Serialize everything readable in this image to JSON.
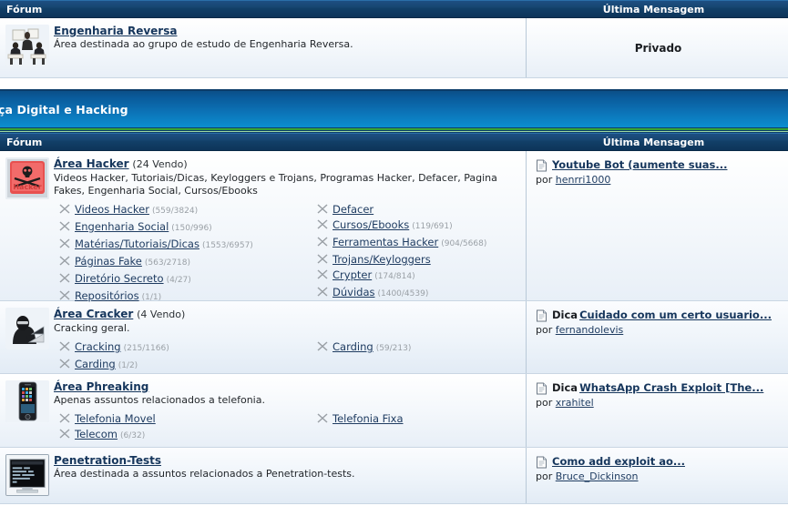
{
  "top_table": {
    "headers": {
      "forum": "Fórum",
      "last_message": "Última Mensagem"
    },
    "rows": [
      {
        "icon": "meeting-photo-icon",
        "title": "Engenharia Reversa",
        "count": "",
        "description": "Área destinada ao grupo de estudo de Engenharia Reversa.",
        "subforums_col1": [],
        "subforums_col2": [],
        "last_message_static": "Privado"
      }
    ]
  },
  "category": {
    "banner_title": "ça Digital e Hacking",
    "headers": {
      "forum": "Fórum",
      "last_message": "Última Mensagem"
    },
    "rows": [
      {
        "icon": "hacker-key-icon",
        "title": "Área Hacker",
        "count": "(24 Vendo)",
        "description": "Videos Hacker, Tutoriais/Dicas, Keyloggers e Trojans, Programas Hacker, Defacer, Pagina Fakes, Engenharia Social, Cursos/Ebooks",
        "subforums_col1": [
          {
            "label": "Videos Hacker",
            "stats": "(559/3824)"
          },
          {
            "label": "Engenharia Social",
            "stats": "(150/996)"
          },
          {
            "label": "Matérias/Tutoriais/Dicas",
            "stats": "(1553/6957)"
          },
          {
            "label": "Páginas Fake",
            "stats": "(563/2718)"
          },
          {
            "label": "Diretório Secreto",
            "stats": "(4/27)"
          },
          {
            "label": "Repositórios",
            "stats": "(1/1)"
          }
        ],
        "subforums_col2": [
          {
            "label": "Defacer",
            "stats": ""
          },
          {
            "label": "Cursos/Ebooks",
            "stats": "(119/691)"
          },
          {
            "label": "Ferramentas Hacker",
            "stats": "(904/5668)"
          },
          {
            "label": "Trojans/Keyloggers",
            "stats": ""
          },
          {
            "label": "Crypter",
            "stats": "(174/814)"
          },
          {
            "label": "Dúvidas",
            "stats": "(1400/4539)"
          }
        ],
        "last_message": {
          "prefix": "",
          "title": "Youtube Bot (aumente suas...",
          "by_label": "por",
          "author": "henrri1000"
        }
      },
      {
        "icon": "masked-hacker-laptop-icon",
        "title": "Área Cracker",
        "count": "(4 Vendo)",
        "description": "Cracking geral.",
        "subforums_col1": [
          {
            "label": "Cracking",
            "stats": "(215/1166)"
          },
          {
            "label": "Carding",
            "stats": "(1/2)"
          }
        ],
        "subforums_col2": [
          {
            "label": "Carding",
            "stats": "(59/213)"
          }
        ],
        "last_message": {
          "prefix": "Dica",
          "title": "Cuidado com um certo usuario...",
          "by_label": "por",
          "author": "fernandolevis"
        }
      },
      {
        "icon": "iphone-icon",
        "title": "Área Phreaking",
        "count": "",
        "description": "Apenas assuntos relacionados a telefonia.",
        "subforums_col1": [
          {
            "label": "Telefonia Movel",
            "stats": ""
          },
          {
            "label": "Telecom",
            "stats": "(6/32)"
          }
        ],
        "subforums_col2": [
          {
            "label": "Telefonia Fixa",
            "stats": ""
          }
        ],
        "last_message": {
          "prefix": "Dica",
          "title": "WhatsApp Crash Exploit [The...",
          "by_label": "por",
          "author": "xrahitel"
        }
      },
      {
        "icon": "terminal-screen-icon",
        "title": "Penetration-Tests",
        "count": "",
        "description": "Área destinada a assuntos relacionados a Penetration-tests.",
        "subforums_col1": [],
        "subforums_col2": [],
        "last_message": {
          "prefix": "",
          "title": "Como add exploit ao...",
          "by_label": "por",
          "author": "Bruce_Dickinson"
        }
      }
    ]
  },
  "colors": {
    "header_blue": "#16456f",
    "banner_blue": "#0c74b8",
    "green_rule": "#2f9a2f",
    "link": "#16365c"
  }
}
